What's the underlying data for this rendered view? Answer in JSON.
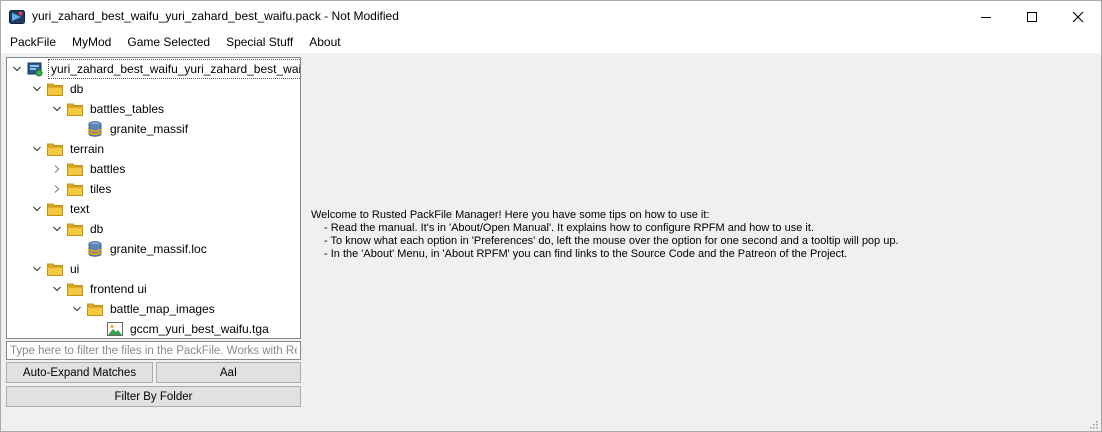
{
  "window": {
    "title": "yuri_zahard_best_waifu_yuri_zahard_best_waifu.pack - Not Modified"
  },
  "menu": [
    "PackFile",
    "MyMod",
    "Game Selected",
    "Special Stuff",
    "About"
  ],
  "tree": [
    {
      "label": "yuri_zahard_best_waifu_yuri_zahard_best_wai...",
      "icon": "packfile-icon",
      "arrow": "expanded"
    },
    {
      "label": "db",
      "icon": "folder-icon",
      "arrow": "expanded"
    },
    {
      "label": "battles_tables",
      "icon": "folder-icon",
      "arrow": "expanded"
    },
    {
      "label": "granite_massif",
      "icon": "database-icon",
      "arrow": "none"
    },
    {
      "label": "terrain",
      "icon": "folder-icon",
      "arrow": "expanded"
    },
    {
      "label": "battles",
      "icon": "folder-icon",
      "arrow": "collapsed"
    },
    {
      "label": "tiles",
      "icon": "folder-icon",
      "arrow": "collapsed"
    },
    {
      "label": "text",
      "icon": "folder-icon",
      "arrow": "expanded"
    },
    {
      "label": "db",
      "icon": "folder-icon",
      "arrow": "expanded"
    },
    {
      "label": "granite_massif.loc",
      "icon": "database-icon",
      "arrow": "none"
    },
    {
      "label": "ui",
      "icon": "folder-icon",
      "arrow": "expanded"
    },
    {
      "label": "frontend ui",
      "icon": "folder-icon",
      "arrow": "expanded"
    },
    {
      "label": "battle_map_images",
      "icon": "folder-icon",
      "arrow": "expanded"
    },
    {
      "label": "gccm_yuri_best_waifu.tga",
      "icon": "image-icon",
      "arrow": "none"
    }
  ],
  "filter": {
    "placeholder": "Type here to filter the files in the PackFile. Works with Re...",
    "value": ""
  },
  "buttons": {
    "auto_expand": "Auto-Expand Matches",
    "case_sensitive": "AaI",
    "filter_by_folder": "Filter By Folder"
  },
  "tips": {
    "intro": "Welcome to Rusted PackFile Manager! Here you have some tips on how to use it:",
    "items": [
      "- Read the manual. It's in 'About/Open Manual'. It explains how to configure RPFM and how to use it.",
      "- To know what each option in 'Preferences' do, left the mouse over the option for one second and a tooltip will pop up.",
      "- In the 'About' Menu, in 'About RPFM' you can find links to the Source Code and the Patreon of the Project."
    ]
  },
  "colors": {
    "folder": "#f5c842",
    "folder_dark": "#dca926",
    "accent": "#0078d7"
  }
}
